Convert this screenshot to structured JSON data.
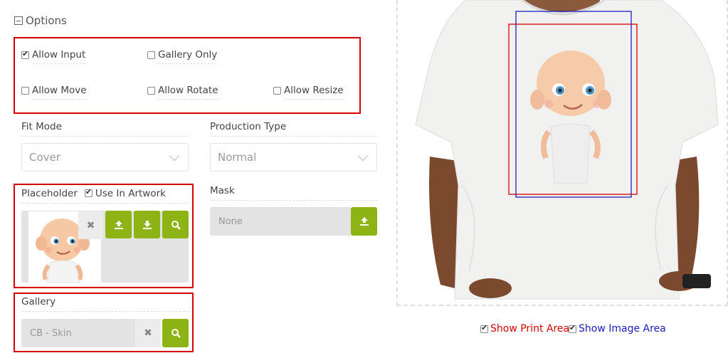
{
  "options": {
    "title": "Options",
    "checkboxes": [
      {
        "label": "Allow Input",
        "checked": true
      },
      {
        "label": "Gallery Only",
        "checked": false
      },
      {
        "label": "Allow Move",
        "checked": false
      },
      {
        "label": "Allow Rotate",
        "checked": false
      },
      {
        "label": "Allow Resize",
        "checked": false
      }
    ]
  },
  "fit_mode": {
    "label": "Fit Mode",
    "value": "Cover"
  },
  "production_type": {
    "label": "Production Type",
    "value": "Normal"
  },
  "placeholder": {
    "label": "Placeholder",
    "use_in_artwork_label": "Use In Artwork",
    "use_in_artwork_checked": true
  },
  "mask": {
    "label": "Mask",
    "value": "None"
  },
  "gallery": {
    "label": "Gallery",
    "value": "CB - Skin"
  },
  "preview": {
    "show_print_area_label": "Show Print Area",
    "show_image_area_label": "Show Image Area",
    "print_area_color": "#d60000",
    "image_area_color": "#2020c0"
  },
  "colors": {
    "accent_green": "#8db314",
    "highlight_red": "#d60000"
  }
}
